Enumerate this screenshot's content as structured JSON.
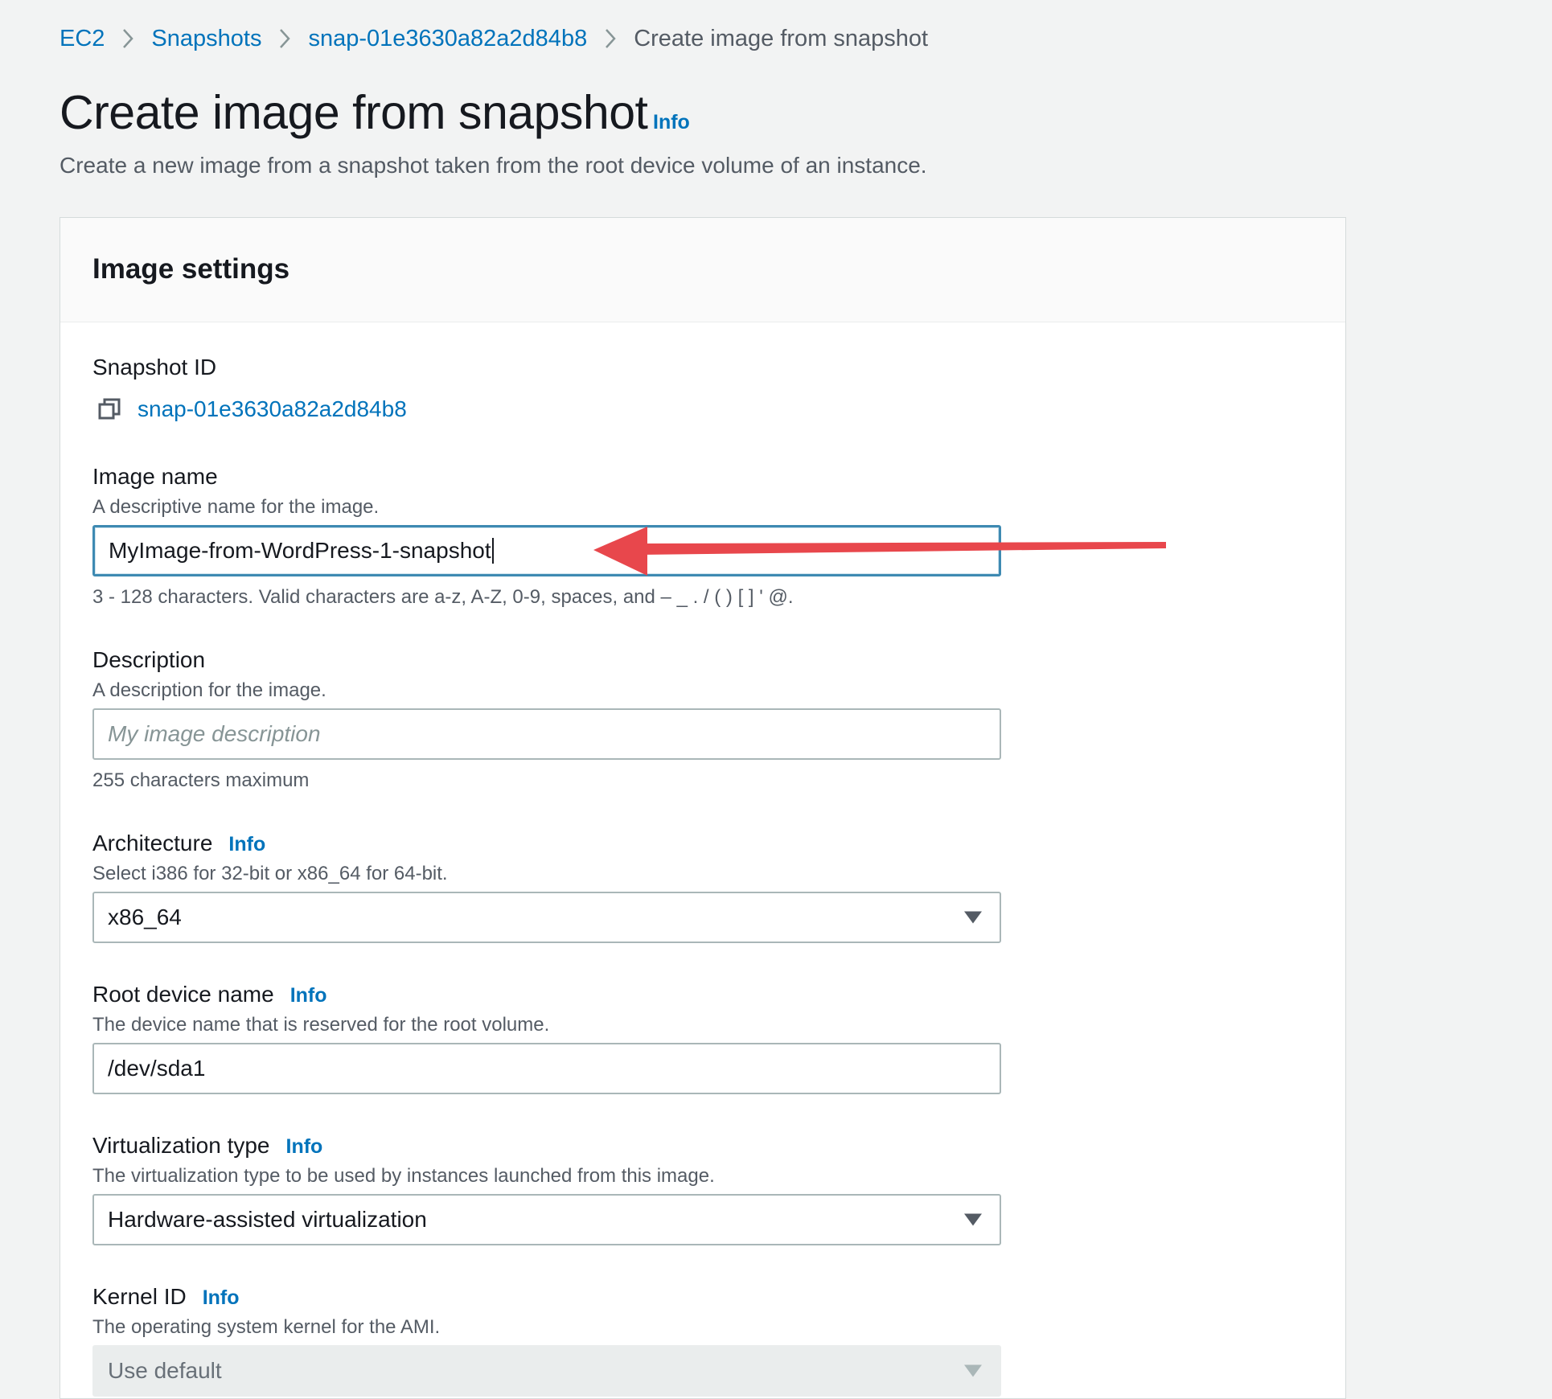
{
  "breadcrumb": {
    "items": [
      "EC2",
      "Snapshots",
      "snap-01e3630a82a2d84b8"
    ],
    "current": "Create image from snapshot"
  },
  "page": {
    "title": "Create image from snapshot",
    "info_label": "Info",
    "description": "Create a new image from a snapshot taken from the root device volume of an instance."
  },
  "panel": {
    "title": "Image settings",
    "snapshot_id": {
      "label": "Snapshot ID",
      "value": "snap-01e3630a82a2d84b8",
      "icon": "copy-icon"
    },
    "image_name": {
      "label": "Image name",
      "description": "A descriptive name for the image.",
      "value": "MyImage-from-WordPress-1-snapshot",
      "constraint": "3 - 128 characters. Valid characters are a-z, A-Z, 0-9, spaces, and – _ . / ( ) [ ] ' @."
    },
    "description": {
      "label": "Description",
      "description": "A description for the image.",
      "placeholder": "My image description",
      "constraint": "255 characters maximum"
    },
    "architecture": {
      "label": "Architecture",
      "info": "Info",
      "description": "Select i386 for 32-bit or x86_64 for 64-bit.",
      "value": "x86_64"
    },
    "root_device": {
      "label": "Root device name",
      "info": "Info",
      "description": "The device name that is reserved for the root volume.",
      "value": "/dev/sda1"
    },
    "virtualization": {
      "label": "Virtualization type",
      "info": "Info",
      "description": "The virtualization type to be used by instances launched from this image.",
      "value": "Hardware-assisted virtualization"
    },
    "kernel_id": {
      "label": "Kernel ID",
      "info": "Info",
      "description": "The operating system kernel for the AMI.",
      "value": "Use default"
    }
  },
  "colors": {
    "link": "#0073bb",
    "annotation_arrow": "#e8474c",
    "focus_border": "#3e8ab2"
  }
}
